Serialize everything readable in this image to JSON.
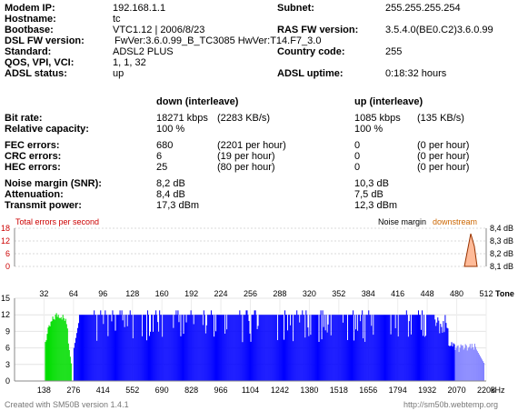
{
  "info": {
    "modem_ip": {
      "label": "Modem IP:",
      "value": "192.168.1.1"
    },
    "hostname": {
      "label": "Hostname:",
      "value": "tc"
    },
    "bootbase": {
      "label": "Bootbase:",
      "value": "VTC1.12 | 2006/8/23"
    },
    "dsl_fw": {
      "label": "DSL FW version:",
      "value": "FwVer:3.6.0.99_B_TC3085 HwVer:T14.F7_3.0"
    },
    "standard": {
      "label": "Standard:",
      "value": "ADSL2 PLUS"
    },
    "qos": {
      "label": "QOS, VPI, VCI:",
      "value": "1, 1, 32"
    },
    "adsl_status": {
      "label": "ADSL status:",
      "value": "up"
    },
    "subnet": {
      "label": "Subnet:",
      "value": "255.255.255.254"
    },
    "ras_fw": {
      "label": "RAS FW version:",
      "value": "3.5.4.0(BE0.C2)3.6.0.99"
    },
    "country": {
      "label": "Country code:",
      "value": "255"
    },
    "uptime": {
      "label": "ADSL uptime:",
      "value": "0:18:32 hours"
    }
  },
  "stats": {
    "down_header": "down (interleave)",
    "up_header": "up (interleave)",
    "bitrate": {
      "label": "Bit rate:",
      "down": "18271 kbps",
      "down_extra": "(2283 KB/s)",
      "up": "1085 kbps",
      "up_extra": "(135 KB/s)"
    },
    "capacity": {
      "label": "Relative capacity:",
      "down": "100 %",
      "up": "100 %"
    },
    "fec": {
      "label": "FEC errors:",
      "down": "680",
      "down_extra": "(2201 per hour)",
      "up": "0",
      "up_extra": "(0 per hour)"
    },
    "crc": {
      "label": "CRC errors:",
      "down": "6",
      "down_extra": "(19 per hour)",
      "up": "0",
      "up_extra": "(0 per hour)"
    },
    "hec": {
      "label": "HEC errors:",
      "down": "25",
      "down_extra": "(80 per hour)",
      "up": "0",
      "up_extra": "(0 per hour)"
    },
    "snr": {
      "label": "Noise margin (SNR):",
      "down": "8,2 dB",
      "up": "10,3 dB"
    },
    "attenuation": {
      "label": "Attenuation:",
      "down": "8,4 dB",
      "up": "7,5 dB"
    },
    "power": {
      "label": "Transmit power:",
      "down": "17,3 dBm",
      "up": "12,3 dBm"
    }
  },
  "errors_chart": {
    "title": "Total errors per second",
    "yticks": [
      "18",
      "12",
      "6",
      "0"
    ],
    "noise_label": "Noise margin",
    "downstream_label": "downstream",
    "snr_ticks": [
      "8,4 dB",
      "8,3 dB",
      "8,2 dB",
      "8,1 dB"
    ],
    "colors": {
      "title": "#cc0000",
      "downstream": "#cc6600",
      "snr_fill": "#ffbb99",
      "snr_line": "#993300"
    }
  },
  "chart_data": {
    "type": "bar",
    "title": "",
    "xlabel": "kHz",
    "ylabel": "",
    "x_top_label": "Tone",
    "top_ticks": [
      "32",
      "64",
      "96",
      "128",
      "160",
      "192",
      "224",
      "256",
      "288",
      "320",
      "352",
      "384",
      "416",
      "448",
      "480",
      "512"
    ],
    "bottom_ticks": [
      "138",
      "276",
      "414",
      "552",
      "690",
      "828",
      "966",
      "1104",
      "1242",
      "1380",
      "1518",
      "1656",
      "1794",
      "1932",
      "2070",
      "2208"
    ],
    "yticks": [
      "15",
      "12",
      "9",
      "6",
      "3",
      "0"
    ],
    "ylim": [
      0,
      15
    ],
    "xlim_tone": [
      0,
      512
    ],
    "series": [
      {
        "color": "#00dd00",
        "tones": [
          33,
          62
        ],
        "typical_bits": 12
      },
      {
        "color": "#0000ff",
        "tones": [
          64,
          478
        ],
        "typical_bits": 12
      },
      {
        "color": "#8080ff",
        "tones": [
          478,
          510
        ],
        "typical_bits": 6
      }
    ]
  },
  "footer": {
    "left": "Created with SM50B version 1.4.1",
    "right": "http://sm50b.webtemp.org"
  }
}
